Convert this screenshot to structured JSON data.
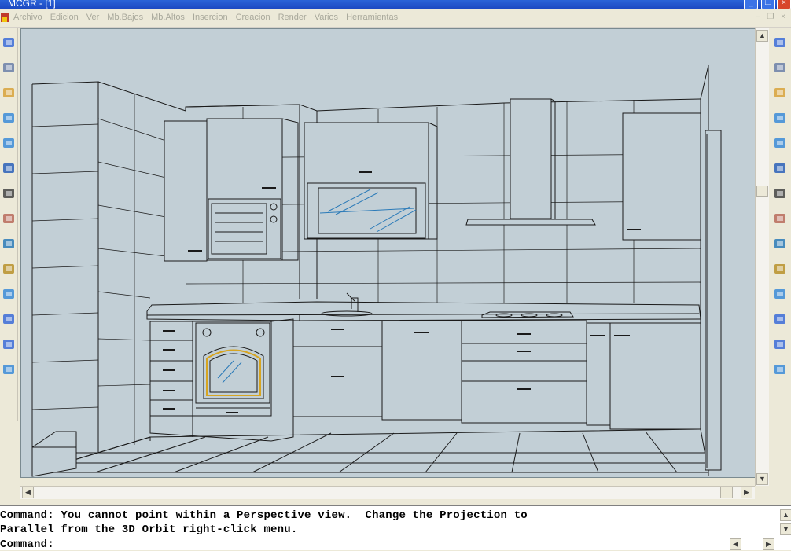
{
  "window": {
    "title": "MCGR - [1]",
    "minimize": "_",
    "restore": "❐",
    "close": "×"
  },
  "menu": [
    {
      "label": "Archivo"
    },
    {
      "label": "Edicion"
    },
    {
      "label": "Ver"
    },
    {
      "label": "Mb.Bajos"
    },
    {
      "label": "Mb.Altos"
    },
    {
      "label": "Insercion"
    },
    {
      "label": "Creacion"
    },
    {
      "label": "Render"
    },
    {
      "label": "Varios"
    },
    {
      "label": "Herramientas"
    }
  ],
  "mdi_controls": {
    "minimize": "–",
    "restore": "❐",
    "close": "×"
  },
  "left_toolbar": [
    "save-icon",
    "print-icon",
    "pencil-icon",
    "undo-icon",
    "redo-icon",
    "zoom-icon",
    "camera-icon",
    "pan-icon",
    "orbit-icon",
    "measure-icon",
    "box-icon",
    "extrude-icon",
    "solid-icon",
    "arrow-icon"
  ],
  "right_toolbar": [
    "view-icon",
    "plane-icon",
    "layers-icon",
    "cabinet-icon",
    "cube-icon",
    "delete-icon",
    "grid-icon",
    "texture-icon",
    "door-icon",
    "panel-icon",
    "wall-icon",
    "plant-icon",
    "edit-icon",
    "ruler-icon"
  ],
  "command": {
    "line1": "Command: You cannot point within a Perspective view.  Change the Projection to",
    "line2": "Parallel from the 3D Orbit right-click menu.",
    "prompt": "Command:"
  },
  "scroll": {
    "up": "▲",
    "down": "▼",
    "left": "◀",
    "right": "▶"
  }
}
